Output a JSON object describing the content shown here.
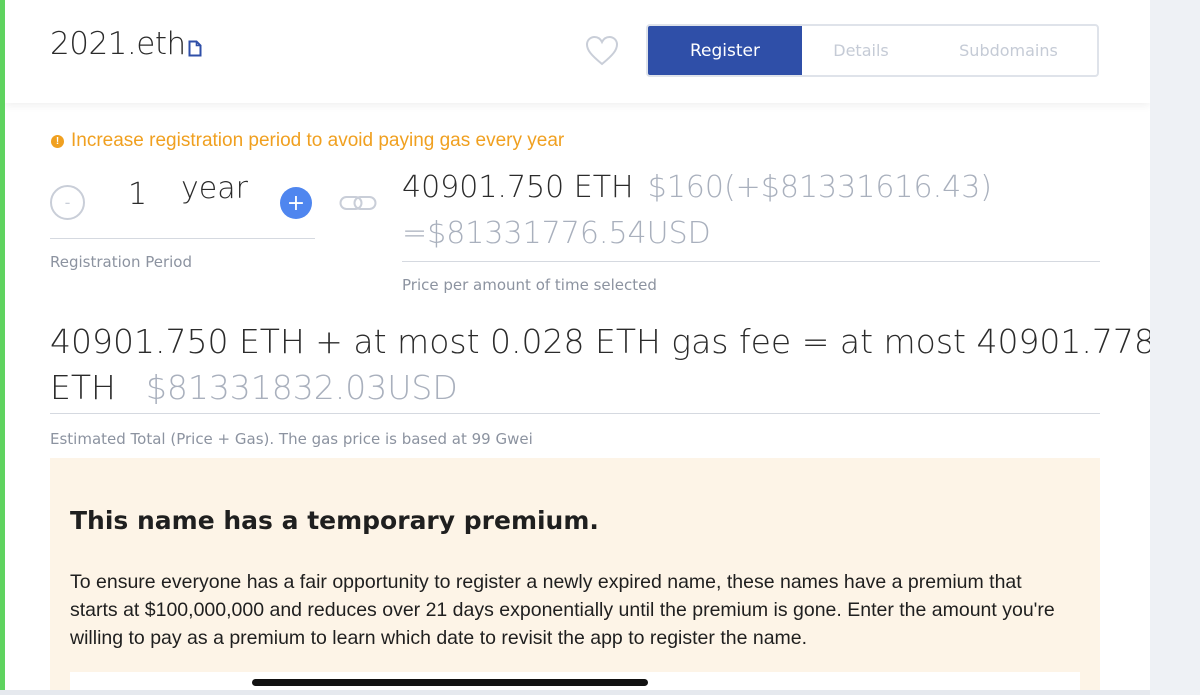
{
  "header": {
    "domain": "2021.eth",
    "tabs": [
      {
        "label": "Register",
        "active": true
      },
      {
        "label": "Details",
        "active": false
      },
      {
        "label": "Subdomains",
        "active": false
      }
    ]
  },
  "warning": {
    "text": "Increase registration period to avoid paying gas every year",
    "color": "#f0a020"
  },
  "period": {
    "minus_symbol": "-",
    "count": "1",
    "unit": "year",
    "plus_symbol": "+",
    "label": "Registration Period"
  },
  "price": {
    "eth": "40901.750 ETH",
    "usd_line1": "$160(+$81331616.43)",
    "usd_line2": "=$81331776.54USD",
    "label": "Price per amount of time selected"
  },
  "total": {
    "line1": "40901.750 ETH + at most 0.028 ETH gas fee = at most 40901.778",
    "line2_eth": "ETH",
    "line2_usd": "$81331832.03USD",
    "label": "Estimated Total (Price + Gas). The gas price is based at 99 Gwei"
  },
  "premium": {
    "title": "This name has a temporary premium.",
    "body": "To ensure everyone has a fair opportunity to register a newly expired name, these names have a premium that starts at $100,000,000 and reduces over 21 days exponentially until the premium is gone. Enter the amount you're willing to pay as a premium to learn which date to revisit the app to register the name."
  },
  "colors": {
    "accent": "#2f4fa8",
    "plus": "#4f86ef",
    "warning": "#f0a020",
    "premium_bg": "#fdf4e7"
  },
  "icons": [
    "copy-icon",
    "heart-icon",
    "link-icon",
    "warning-icon"
  ]
}
